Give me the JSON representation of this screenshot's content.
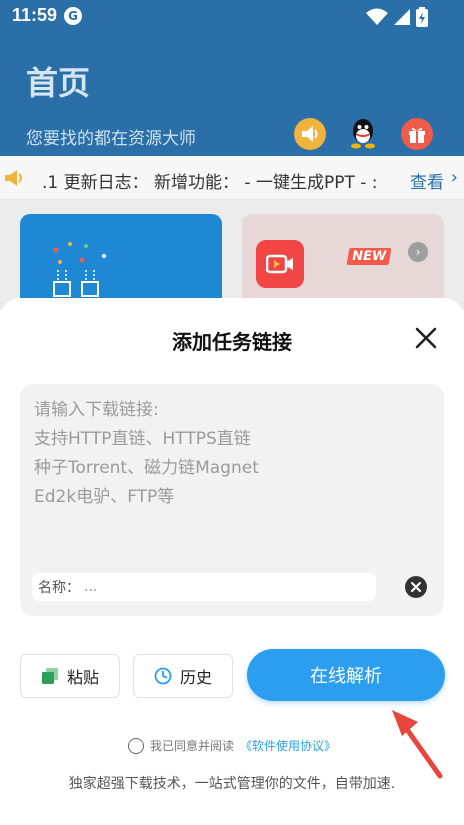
{
  "status": {
    "time": "11:59",
    "app_badge": "G"
  },
  "header": {
    "title": "首页",
    "subtitle": "您要找的都在资源大师"
  },
  "notice": {
    "text": ".1 更新日志： 新增功能：  - 一键生成PPT - :",
    "more": "查看",
    "chevron": "›"
  },
  "cards": {
    "new_badge": "NEW",
    "arrow": "›"
  },
  "dialog": {
    "title": "添加任务链接",
    "link_lines": [
      "请输入下载链接:",
      " 支持HTTP直链、HTTPS直链",
      " 种子Torrent、磁力链Magnet",
      " Ed2k电驴、FTP等"
    ],
    "name_label": "名称：",
    "name_placeholder": "...",
    "paste_label": "粘贴",
    "history_label": "历史",
    "parse_label": "在线解析",
    "agree_text": "我已同意并阅读",
    "agree_link": "《软件使用协议》",
    "footer": "独家超强下载技术，一站式管理你的文件，自带加速."
  },
  "colors": {
    "header_bg": "#2a6fa7",
    "accent": "#2c9ef0",
    "arrow_red": "#e8453c"
  }
}
